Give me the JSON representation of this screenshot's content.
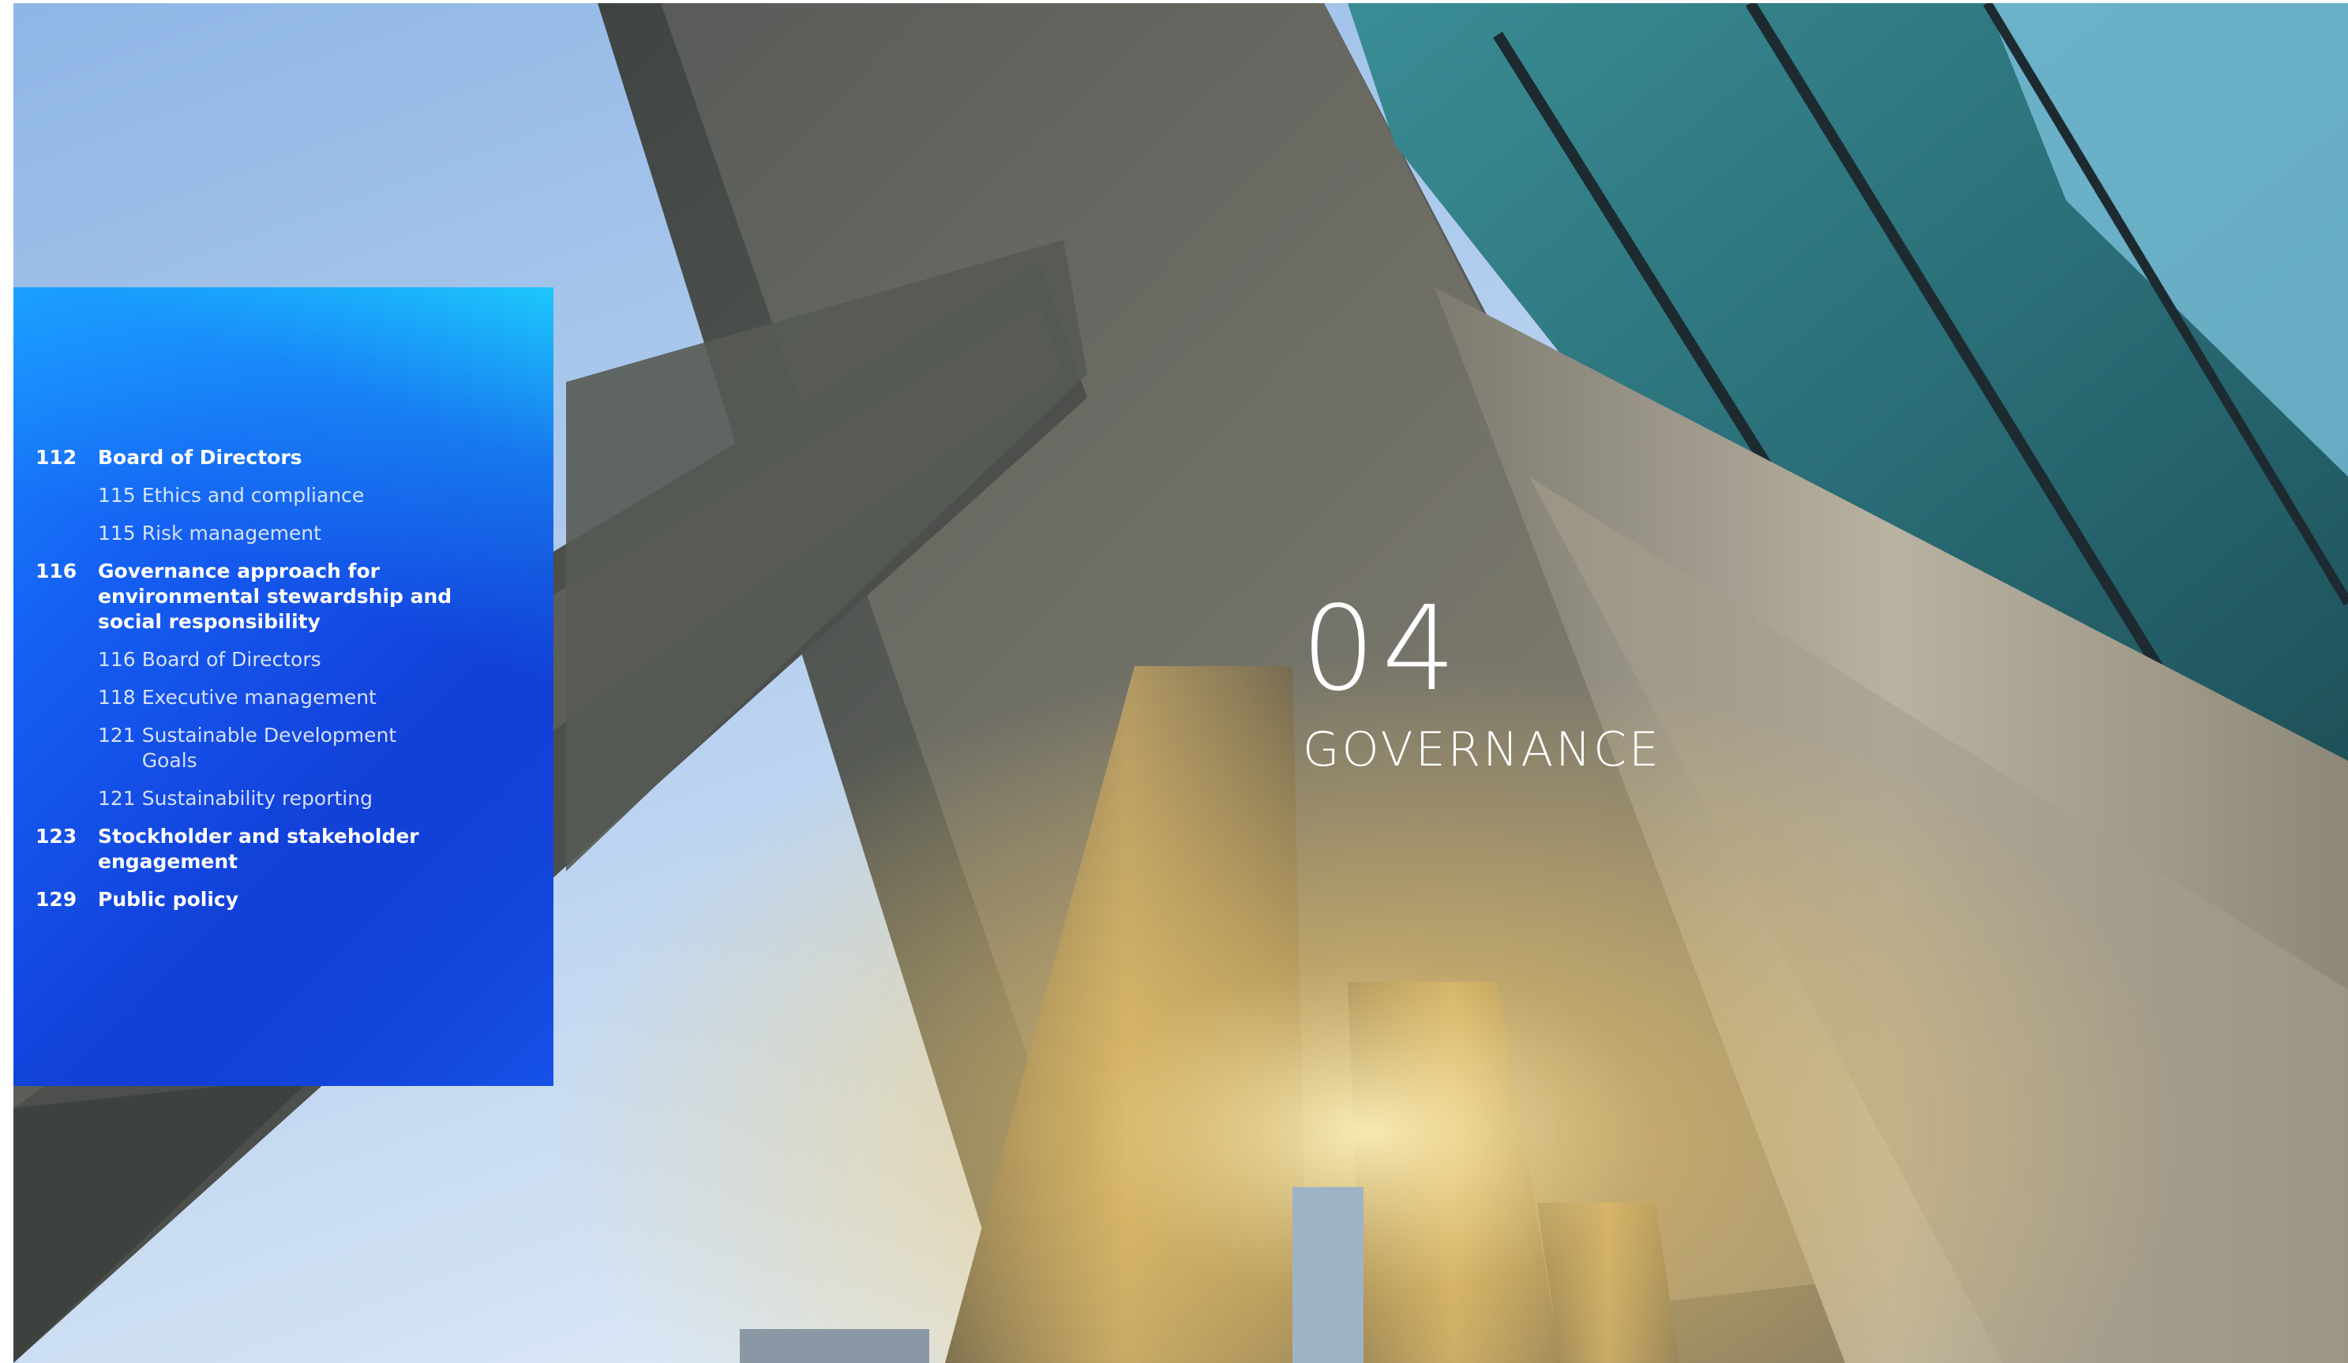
{
  "chapter": {
    "number": "04",
    "title": "GOVERNANCE"
  },
  "toc": {
    "entries": [
      {
        "level": "main",
        "page": "112",
        "title": "Board of Directors"
      },
      {
        "level": "sub",
        "page": "115",
        "title": "Ethics and compliance"
      },
      {
        "level": "sub",
        "page": "115",
        "title": "Risk management"
      },
      {
        "level": "main",
        "page": "116",
        "title": "Governance approach for environmental stewardship and social responsibility"
      },
      {
        "level": "sub",
        "page": "116",
        "title": "Board of Directors"
      },
      {
        "level": "sub",
        "page": "118",
        "title": "Executive management"
      },
      {
        "level": "sub",
        "page": "121",
        "title": "Sustainable Development Goals"
      },
      {
        "level": "sub",
        "page": "121",
        "title": "Sustainability reporting"
      },
      {
        "level": "main",
        "page": "123",
        "title": "Stockholder and stakeholder engagement"
      },
      {
        "level": "main",
        "page": "129",
        "title": "Public policy"
      }
    ]
  },
  "colors": {
    "panel_start": "#1a8dff",
    "panel_end": "#0b2aa6",
    "text": "#ffffff"
  }
}
